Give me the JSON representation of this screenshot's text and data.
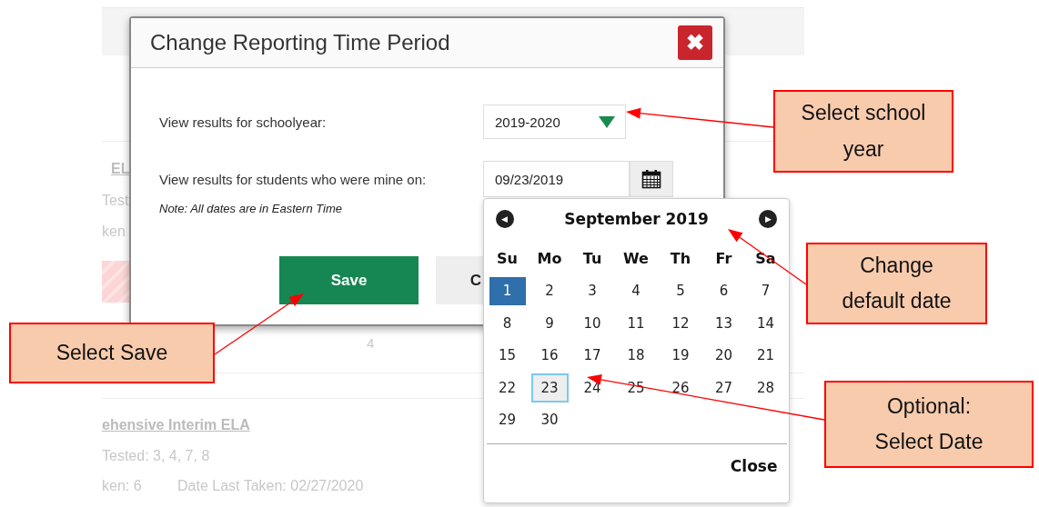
{
  "background_page": {
    "link_1": "EL",
    "text_1": "Test",
    "text_2": "ken",
    "number": "4",
    "link_2": "ehensive Interim ELA",
    "grades_tested": "Tested: 3, 4, 7, 8",
    "times_taken": "ken: 6",
    "date_last_taken": "Date Last Taken: 02/27/2020"
  },
  "dialog": {
    "title": "Change Reporting Time Period",
    "close_label": "✖",
    "schoolyear_label": "View results for schoolyear:",
    "schoolyear_value": "2019-2020",
    "date_label": "View results for students who were mine on:",
    "date_value": "09/23/2019",
    "note": "Note: All dates are in Eastern Time",
    "buttons": [
      {
        "label": "Save",
        "kind": "primary"
      },
      {
        "label": "C",
        "kind": "secondary"
      }
    ]
  },
  "datepicker": {
    "month": "September 2019",
    "prev_label": "◀",
    "next_label": "▶",
    "weekdays": [
      "Su",
      "Mo",
      "Tu",
      "We",
      "Th",
      "Fr",
      "Sa"
    ],
    "weeks": [
      [
        {
          "day": "1",
          "active": true,
          "selected": false
        },
        {
          "day": "2",
          "active": false,
          "selected": false
        },
        {
          "day": "3",
          "active": false,
          "selected": false
        },
        {
          "day": "4",
          "active": false,
          "selected": false
        },
        {
          "day": "5",
          "active": false,
          "selected": false
        },
        {
          "day": "6",
          "active": false,
          "selected": false
        },
        {
          "day": "7",
          "active": false,
          "selected": false
        }
      ],
      [
        {
          "day": "8",
          "active": false,
          "selected": false
        },
        {
          "day": "9",
          "active": false,
          "selected": false
        },
        {
          "day": "10",
          "active": false,
          "selected": false
        },
        {
          "day": "11",
          "active": false,
          "selected": false
        },
        {
          "day": "12",
          "active": false,
          "selected": false
        },
        {
          "day": "13",
          "active": false,
          "selected": false
        },
        {
          "day": "14",
          "active": false,
          "selected": false
        }
      ],
      [
        {
          "day": "15",
          "active": false,
          "selected": false
        },
        {
          "day": "16",
          "active": false,
          "selected": false
        },
        {
          "day": "17",
          "active": false,
          "selected": false
        },
        {
          "day": "18",
          "active": false,
          "selected": false
        },
        {
          "day": "19",
          "active": false,
          "selected": false
        },
        {
          "day": "20",
          "active": false,
          "selected": false
        },
        {
          "day": "21",
          "active": false,
          "selected": false
        }
      ],
      [
        {
          "day": "22",
          "active": false,
          "selected": false
        },
        {
          "day": "23",
          "active": false,
          "selected": true
        },
        {
          "day": "24",
          "active": false,
          "selected": false
        },
        {
          "day": "25",
          "active": false,
          "selected": false
        },
        {
          "day": "26",
          "active": false,
          "selected": false
        },
        {
          "day": "27",
          "active": false,
          "selected": false
        },
        {
          "day": "28",
          "active": false,
          "selected": false
        }
      ],
      [
        {
          "day": "29",
          "active": false,
          "selected": false
        },
        {
          "day": "30",
          "active": false,
          "selected": false
        }
      ]
    ],
    "close_label": "Close"
  },
  "annotations": [
    {
      "text": "Select school year"
    },
    {
      "text": "Change default date"
    },
    {
      "text": "Optional: Select Date"
    },
    {
      "text": "Select Save"
    }
  ]
}
